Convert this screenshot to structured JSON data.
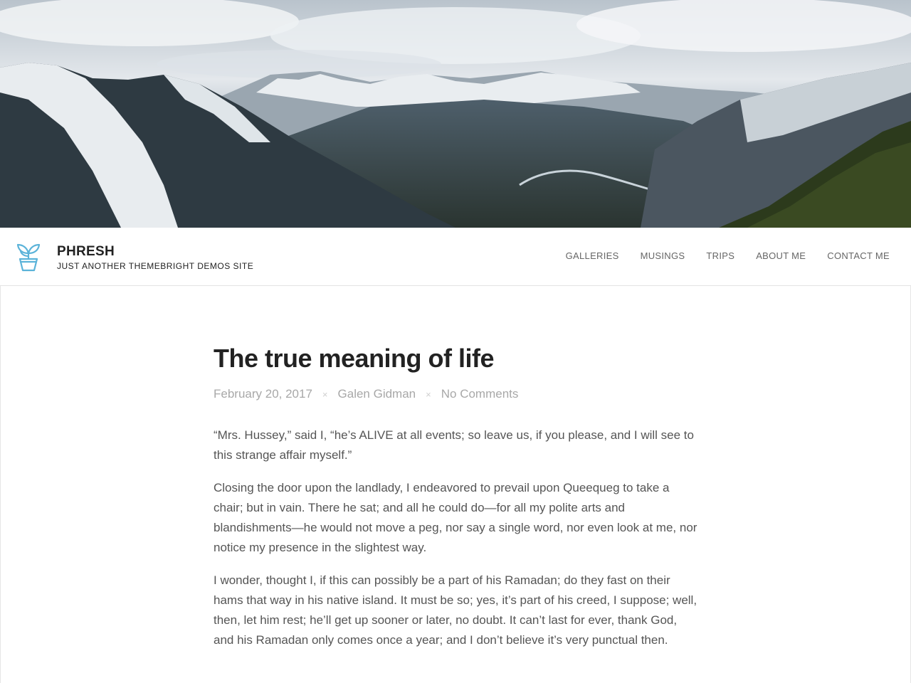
{
  "hero": {
    "alt": "Snowy mountain range over a river valley"
  },
  "site": {
    "title": "PHRESH",
    "tagline": "JUST ANOTHER THEMEBRIGHT DEMOS SITE",
    "logo_icon": "plant-pot-icon",
    "accent_color": "#5bb3d9"
  },
  "nav": {
    "items": [
      {
        "label": "GALLERIES"
      },
      {
        "label": "MUSINGS"
      },
      {
        "label": "TRIPS"
      },
      {
        "label": "ABOUT ME"
      },
      {
        "label": "CONTACT ME"
      }
    ]
  },
  "post": {
    "title": "The true meaning of life",
    "date": "February 20, 2017",
    "separator": "×",
    "author": "Galen Gidman",
    "comments": "No Comments",
    "paragraphs": [
      "“Mrs. Hussey,” said I, “he’s ALIVE at all events; so leave us, if you please, and I will see to this strange affair myself.”",
      "Closing the door upon the landlady, I endeavored to prevail upon Queequeg to take a chair; but in vain. There he sat; and all he could do—for all my polite arts and blandishments—he would not move a peg, nor say a single word, nor even look at me, nor notice my presence in the slightest way.",
      "I wonder, thought I, if this can possibly be a part of his Ramadan; do they fast on their hams that way in his native island. It must be so; yes, it’s part of his creed, I suppose; well, then, let him rest; he’ll get up sooner or later, no doubt. It can’t last for ever, thank God, and his Ramadan only comes once a year; and I don’t believe it’s very punctual then."
    ]
  }
}
